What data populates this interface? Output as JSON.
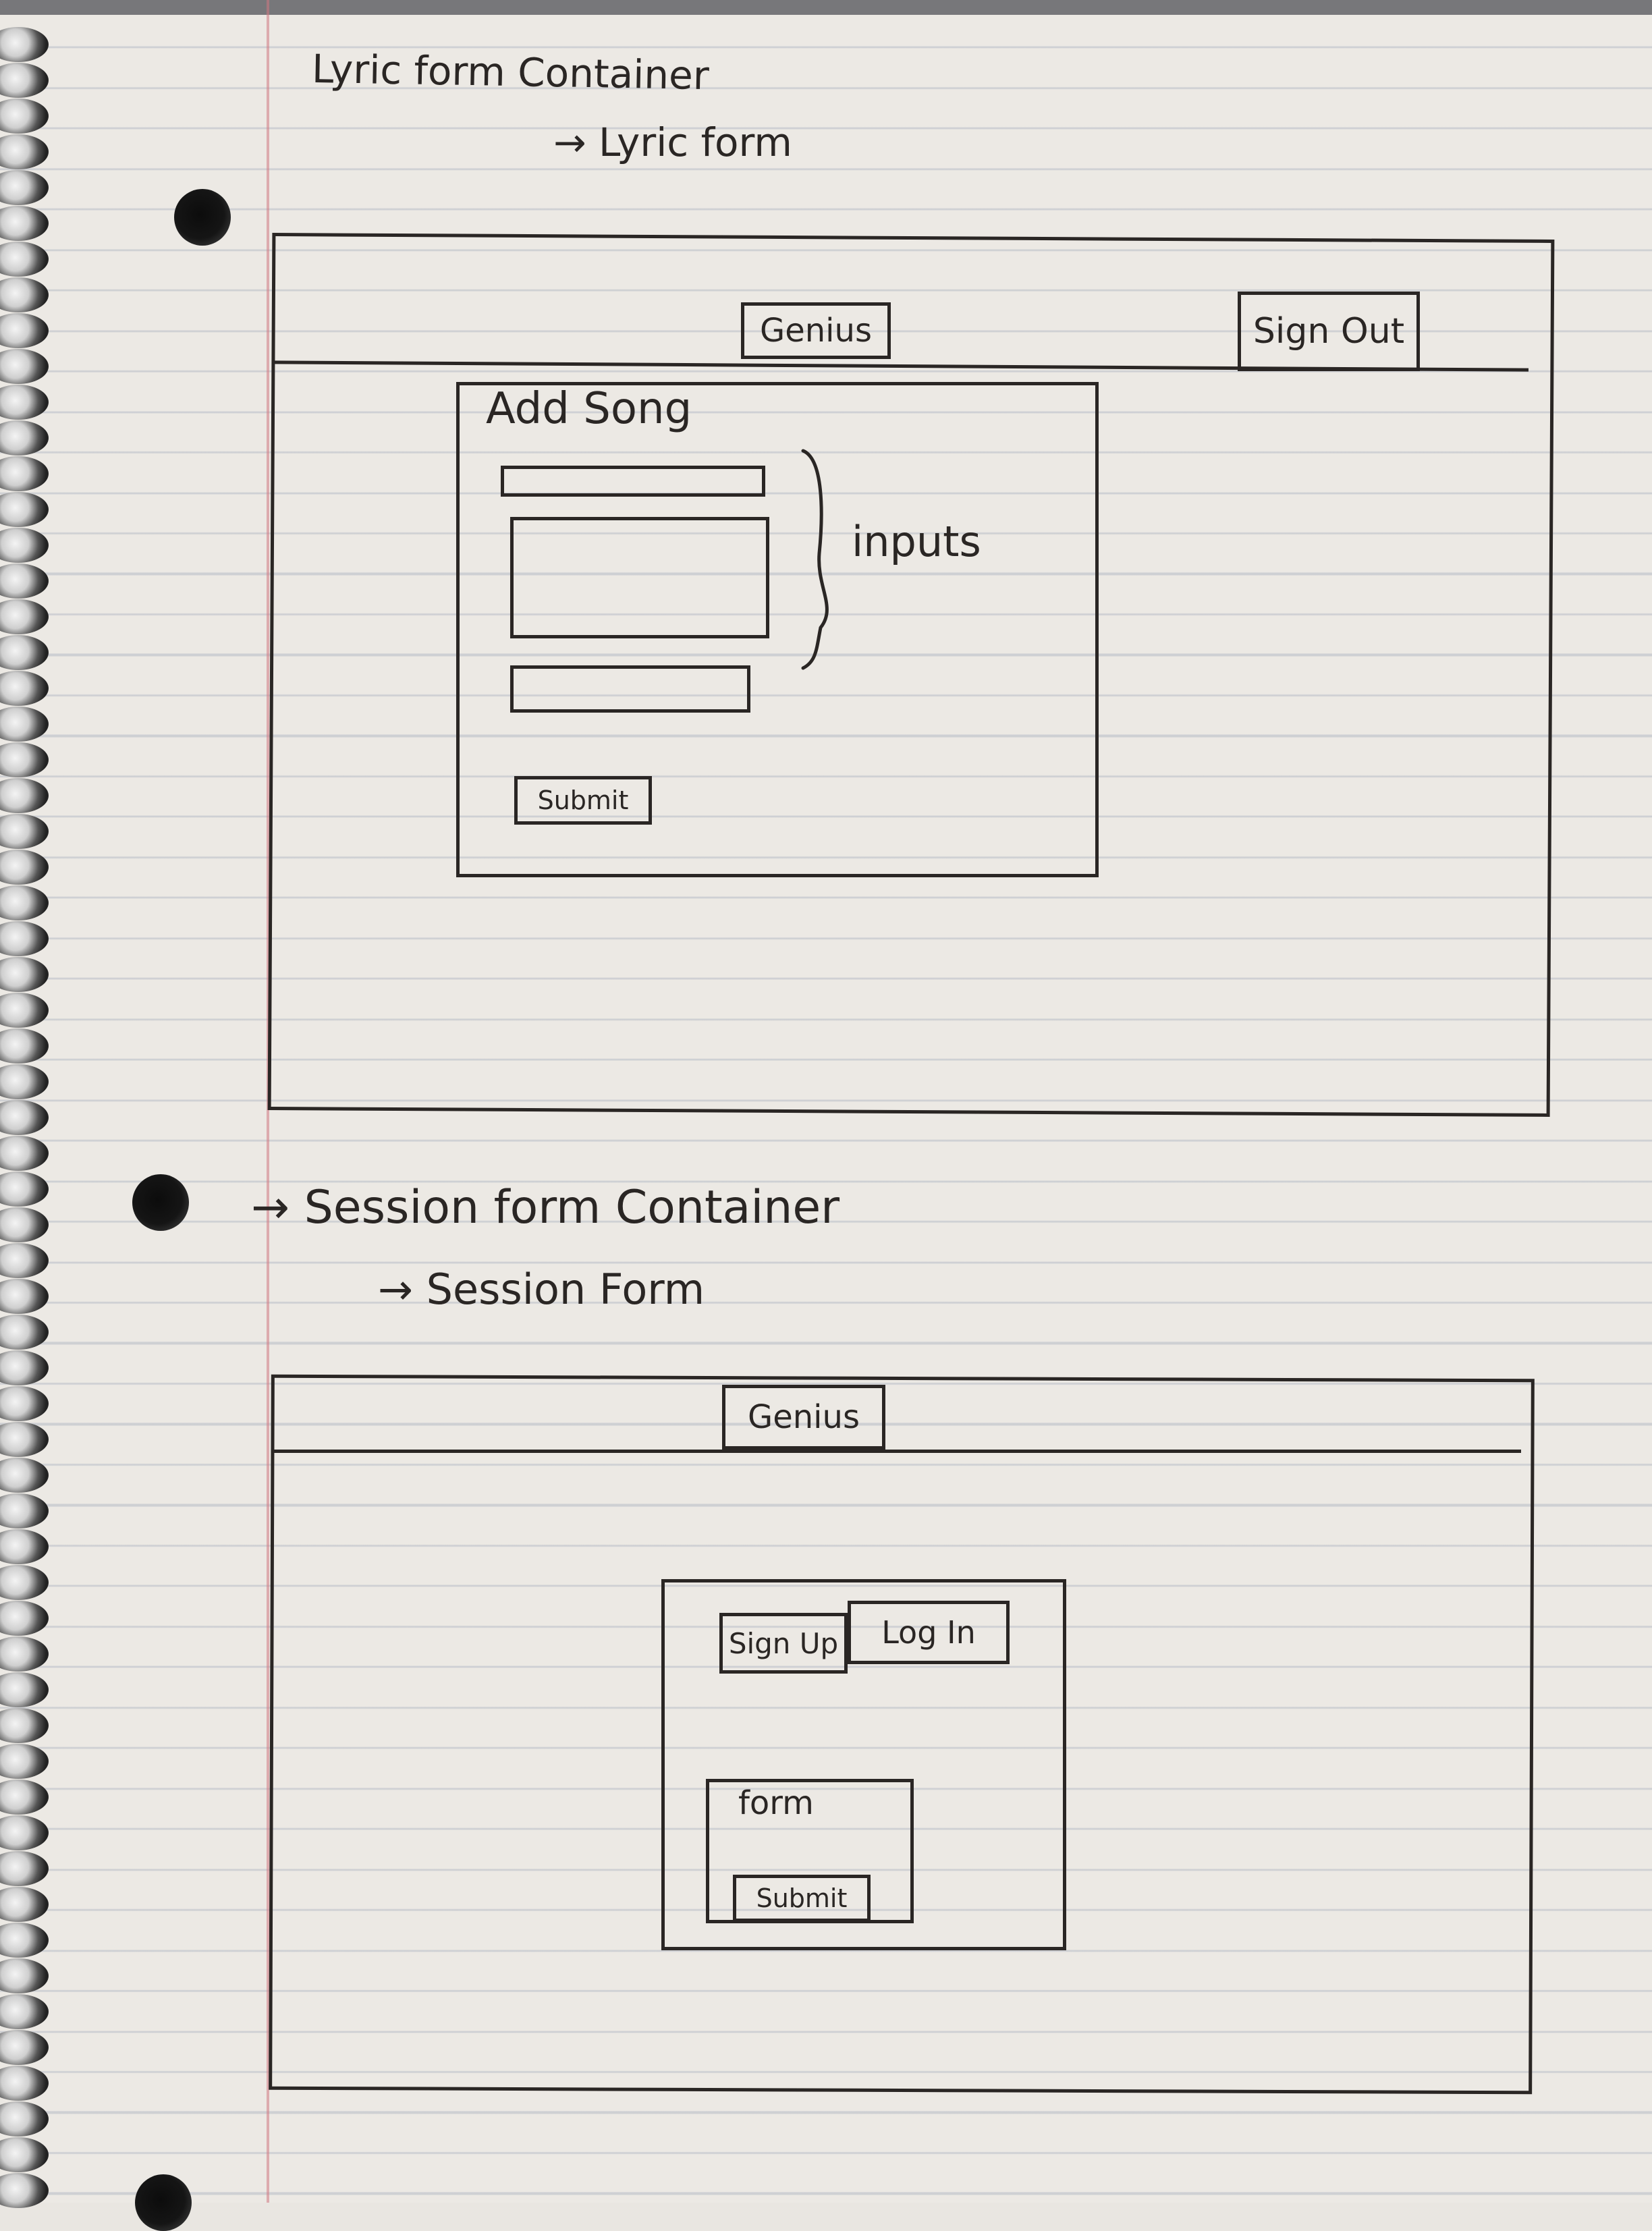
{
  "lyric_section": {
    "heading": "Lyric form Container",
    "subheading": "→ Lyric form",
    "nav": {
      "logo_label": "Genius",
      "signout_label": "Sign Out"
    },
    "form": {
      "title": "Add Song",
      "inputs_label": "inputs",
      "submit_label": "Submit"
    }
  },
  "session_section": {
    "heading": "→ Session form Container",
    "subheading": "→ Session Form",
    "nav": {
      "logo_label": "Genius"
    },
    "panel": {
      "signup_label": "Sign Up",
      "login_label": "Log In",
      "form_label": "form",
      "submit_label": "Submit"
    }
  },
  "colors": {
    "ink": "#2a2624",
    "paper": "#ece9e4",
    "rule_line": "#96a0b4",
    "margin_line": "#d27882"
  }
}
